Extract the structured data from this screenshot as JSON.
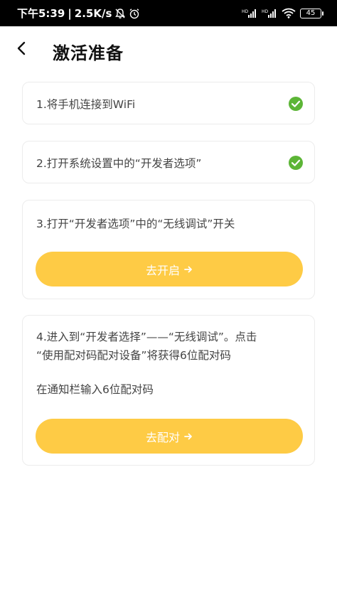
{
  "status_bar": {
    "time": "下午5:39",
    "separator": "|",
    "net_speed": "2.5K/s",
    "battery": "45",
    "icons": [
      "mute-icon",
      "alarm-icon",
      "hd-signal-icon",
      "hd-signal-icon",
      "wifi-icon",
      "battery-icon"
    ]
  },
  "header": {
    "title": "激活准备",
    "back_icon": "chevron-left-icon"
  },
  "steps": [
    {
      "text": "1.将手机连接到WiFi",
      "done": true
    },
    {
      "text": "2.打开系统设置中的“开发者选项”",
      "done": true
    },
    {
      "text": "3.打开“开发者选项”中的“无线调试”开关",
      "button": "去开启"
    },
    {
      "line1": "4.进入到“开发者选择”——“无线调试”。点击",
      "line2": "“使用配对码配对设备”将获得6位配对码",
      "note": "在通知栏输入6位配对码",
      "button": "去配对"
    }
  ],
  "colors": {
    "accent": "#fecb45",
    "check": "#5cb536",
    "card_border": "#ececec"
  }
}
